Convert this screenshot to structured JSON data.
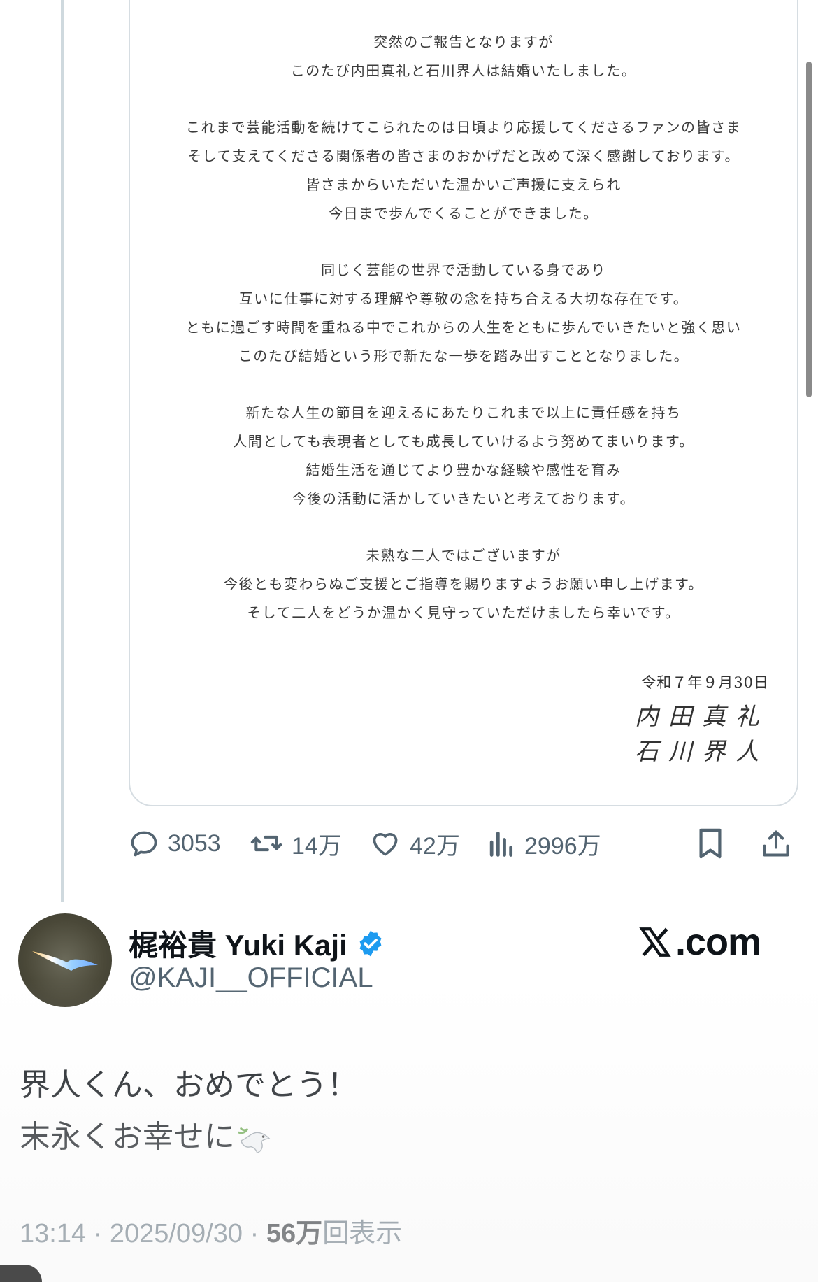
{
  "quoted_image": {
    "paragraphs": [
      [
        "突然のご報告となりますが",
        "このたび内田真礼と石川界人は結婚いたしました。"
      ],
      [
        "これまで芸能活動を続けてこられたのは日頃より応援してくださるファンの皆さま",
        "そして支えてくださる関係者の皆さまのおかげだと改めて深く感謝しております。",
        "皆さまからいただいた温かいご声援に支えられ",
        "今日まで歩んでくることができました。"
      ],
      [
        "同じく芸能の世界で活動している身であり",
        "互いに仕事に対する理解や尊敬の念を持ち合える大切な存在です。",
        "ともに過ごす時間を重ねる中でこれからの人生をともに歩んでいきたいと強く思い",
        "このたび結婚という形で新たな一歩を踏み出すこととなりました。"
      ],
      [
        "新たな人生の節目を迎えるにあたりこれまで以上に責任感を持ち",
        "人間としても表現者としても成長していけるよう努めてまいります。",
        "結婚生活を通じてより豊かな経験や感性を育み",
        "今後の活動に活かしていきたいと考えております。"
      ],
      [
        "未熟な二人ではございますが",
        "今後とも変わらぬご支援とご指導を賜りますようお願い申し上げます。",
        "そして二人をどうか温かく見守っていただけましたら幸いです。"
      ]
    ],
    "date": "令和７年９月30日",
    "signature_1": "内田真礼",
    "signature_2": "石川界人"
  },
  "actions": {
    "replies": "3053",
    "reposts": "14万",
    "likes": "42万",
    "views": "2996万"
  },
  "author": {
    "display_name": "梶裕貴 Yuki Kaji",
    "handle": "@KAJI__OFFICIAL",
    "verified": true
  },
  "watermark": "X.com",
  "tweet": {
    "line1": "界人くん、おめでとう！",
    "line2": "末永くお幸せに",
    "emoji_icon": "dove-with-olive-branch"
  },
  "meta": {
    "time": "13:14",
    "separator": "·",
    "date": "2025/09/30",
    "views_count": "56万",
    "views_label": "回表示"
  },
  "colors": {
    "text": "#0f1419",
    "secondary": "#536471",
    "verified": "#1d9bf0",
    "thread_line": "#cfd9de"
  }
}
